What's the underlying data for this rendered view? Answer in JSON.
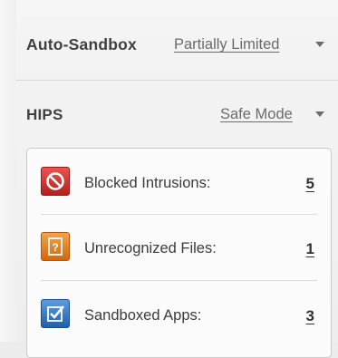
{
  "auto_sandbox": {
    "label": "Auto-Sandbox",
    "value": "Partially Limited",
    "dropdown_icon": "chevron-down-icon"
  },
  "hips": {
    "label": "HIPS",
    "value": "Safe Mode",
    "dropdown_icon": "chevron-down-icon"
  },
  "stats": [
    {
      "label": "Blocked Intrusions:",
      "count": "5",
      "icon": "blocked-icon",
      "color": "#d42a2a"
    },
    {
      "label": "Unrecognized Files:",
      "count": "1",
      "icon": "unrecognized-file-icon",
      "color": "#e07b1c"
    },
    {
      "label": "Sandboxed Apps:",
      "count": "3",
      "icon": "sandbox-check-icon",
      "color": "#2d74c4"
    }
  ]
}
